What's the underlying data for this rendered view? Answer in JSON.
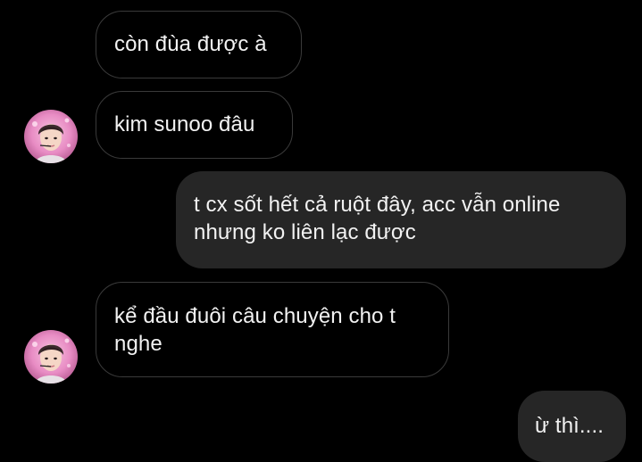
{
  "conversation": {
    "messages": [
      {
        "sender": "contact",
        "text": "còn đùa được à"
      },
      {
        "sender": "contact",
        "text": "kim sunoo đâu"
      },
      {
        "sender": "me",
        "text": "t cx sốt hết cả ruột đây, acc vẫn online nhưng ko liên lạc được"
      },
      {
        "sender": "contact",
        "text": "kể đầu đuôi câu chuyện cho t nghe"
      },
      {
        "sender": "me",
        "text": "ừ thì...."
      }
    ],
    "avatar_icon": "profile-photo-icon"
  },
  "colors": {
    "background": "#000000",
    "incoming_border": "#3a3a3a",
    "outgoing_bubble": "#262626",
    "text": "#f2f2f2",
    "avatar_accent": "#e88cc4"
  }
}
